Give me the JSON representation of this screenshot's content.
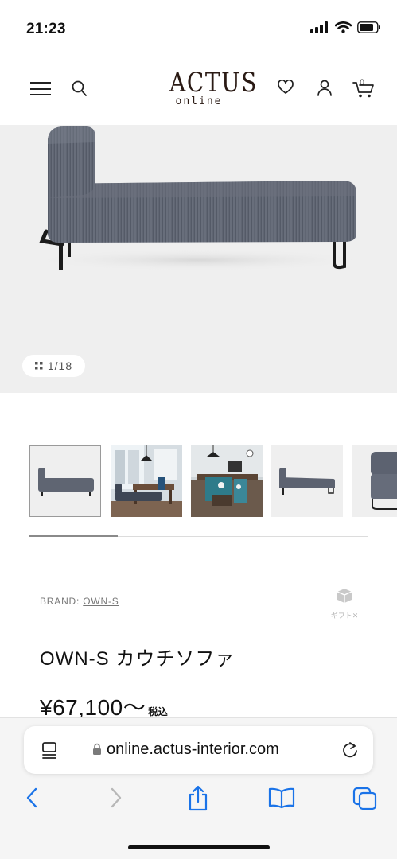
{
  "status_bar": {
    "time": "21:23"
  },
  "header": {
    "logo_main": "ACTUS",
    "logo_sub": "online",
    "cart_count": "0"
  },
  "gallery": {
    "counter": "1/18",
    "thumbnail_count": 5,
    "progress_fraction": 0.26
  },
  "product": {
    "brand_label": "BRAND:",
    "brand_name": "OWN-S",
    "gift_label": "ギフト✕",
    "name": "OWN-S カウチソファ",
    "price": "¥67,100～",
    "tax_label": "税込"
  },
  "browser": {
    "url": "online.actus-interior.com"
  },
  "colors": {
    "hero_bg": "#efefef",
    "sofa_fabric": "#5f6572",
    "accent_blue": "#1a73e8",
    "logo_brown": "#2a1a14"
  }
}
